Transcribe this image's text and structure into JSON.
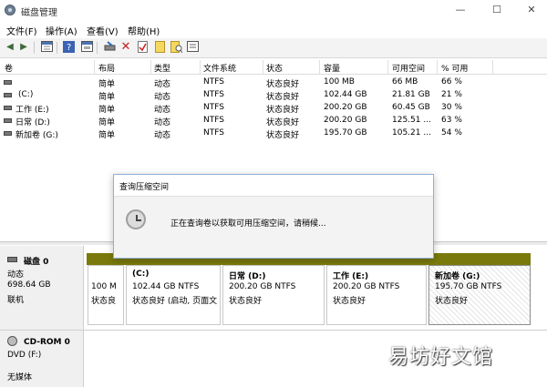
{
  "window": {
    "title": "磁盘管理",
    "controls": [
      "—",
      "☐",
      "✕"
    ]
  },
  "menu": [
    "文件(F)",
    "操作(A)",
    "查看(V)",
    "帮助(H)"
  ],
  "toolbar": {
    "icons": [
      "back-arrow-icon",
      "forward-arrow-icon",
      "console-tree-icon",
      "help-icon",
      "properties-icon",
      "connect-disk-icon",
      "delete-icon",
      "check-icon",
      "new-volume-icon",
      "search-icon",
      "settings-icon"
    ]
  },
  "columns": [
    "卷",
    "布局",
    "类型",
    "文件系统",
    "状态",
    "容量",
    "可用空间",
    "% 可用"
  ],
  "volumes": [
    {
      "name": "",
      "layout": "简单",
      "type": "动态",
      "fs": "NTFS",
      "status": "状态良好",
      "capacity": "100 MB",
      "free": "66 MB",
      "pct": "66 %"
    },
    {
      "name": "(C:)",
      "layout": "简单",
      "type": "动态",
      "fs": "NTFS",
      "status": "状态良好",
      "capacity": "102.44 GB",
      "free": "21.81 GB",
      "pct": "21 %"
    },
    {
      "name": "工作 (E:)",
      "layout": "简单",
      "type": "动态",
      "fs": "NTFS",
      "status": "状态良好",
      "capacity": "200.20 GB",
      "free": "60.45 GB",
      "pct": "30 %"
    },
    {
      "name": "日常 (D:)",
      "layout": "简单",
      "type": "动态",
      "fs": "NTFS",
      "status": "状态良好",
      "capacity": "200.20 GB",
      "free": "125.51 ...",
      "pct": "63 %"
    },
    {
      "name": "新加卷 (G:)",
      "layout": "简单",
      "type": "动态",
      "fs": "NTFS",
      "status": "状态良好",
      "capacity": "195.70 GB",
      "free": "105.21 ...",
      "pct": "54 %"
    }
  ],
  "disk0": {
    "name": "磁盘 0",
    "type": "动态",
    "size": "698.64 GB",
    "state": "联机"
  },
  "partitions": [
    {
      "title": "",
      "size": "100 M",
      "status": "状态良"
    },
    {
      "title": "(C:)",
      "size": "102.44 GB NTFS",
      "status": "状态良好 (启动, 页面文"
    },
    {
      "title": "日常  (D:)",
      "size": "200.20 GB NTFS",
      "status": "状态良好"
    },
    {
      "title": "工作  (E:)",
      "size": "200.20 GB NTFS",
      "status": "状态良好"
    },
    {
      "title": "新加卷  (G:)",
      "size": "195.70 GB NTFS",
      "status": "状态良好"
    }
  ],
  "cdrom": {
    "name": "CD-ROM 0",
    "drive": "DVD (F:)",
    "media": "无媒体"
  },
  "dialog": {
    "title": "查询压缩空间",
    "message": "正在查询卷以获取可用压缩空间，请稍候..."
  },
  "watermark": "易坊好文馆",
  "colors": {
    "disk_bar": "#7a7a0c",
    "dialog_border": "#8fb1d8"
  }
}
